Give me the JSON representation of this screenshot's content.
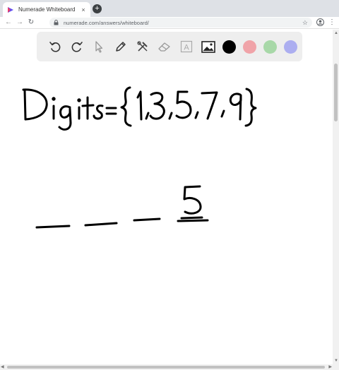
{
  "browser": {
    "tab_title": "Numerade Whiteboard",
    "tab_close": "×",
    "new_tab": "+",
    "url": "numerade.com/answers/whiteboard/",
    "back": "←",
    "forward": "→",
    "reload": "↻",
    "star": "☆",
    "menu": "⋮"
  },
  "whiteboard": {
    "tools": [
      "undo-icon",
      "redo-icon",
      "select-pointer-icon",
      "pen-icon",
      "tools-icon",
      "eraser-icon",
      "text-icon",
      "image-icon"
    ],
    "text_tool_label": "A",
    "colors": [
      {
        "name": "black",
        "hex": "#000000",
        "selected": true
      },
      {
        "name": "red",
        "hex": "#f0a3a8",
        "selected": false
      },
      {
        "name": "green",
        "hex": "#a8d8a8",
        "selected": false
      },
      {
        "name": "blue",
        "hex": "#acaef0",
        "selected": false
      }
    ]
  },
  "handwriting": {
    "line1": "Digits = {1,3,5,7,9}",
    "blanks": [
      "_",
      "_",
      "_",
      "5"
    ]
  }
}
